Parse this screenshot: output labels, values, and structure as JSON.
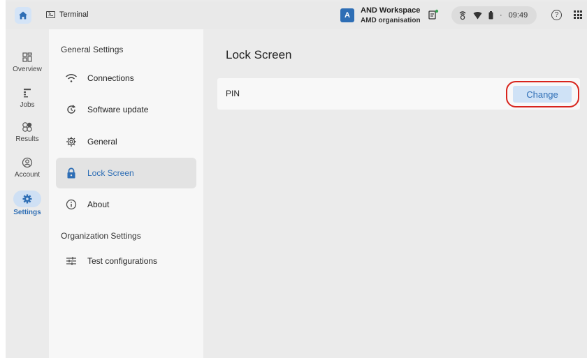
{
  "topbar": {
    "terminal_label": "Terminal",
    "workspace_initial": "A",
    "workspace_name": "AND Workspace",
    "organisation": "AMD organisation",
    "time": "09:49",
    "separator": "·",
    "help_glyph": "?"
  },
  "rail": {
    "items": [
      {
        "label": "Overview",
        "icon": "dashboard-icon"
      },
      {
        "label": "Jobs",
        "icon": "jobs-icon"
      },
      {
        "label": "Results",
        "icon": "results-icon"
      },
      {
        "label": "Account",
        "icon": "account-icon"
      },
      {
        "label": "Settings",
        "icon": "gear-icon",
        "active": true
      }
    ]
  },
  "nav": {
    "general_heading": "General Settings",
    "items": [
      {
        "label": "Connections",
        "icon": "wifi-icon"
      },
      {
        "label": "Software update",
        "icon": "update-icon"
      },
      {
        "label": "General",
        "icon": "gear-icon"
      },
      {
        "label": "Lock Screen",
        "icon": "lock-icon",
        "active": true
      },
      {
        "label": "About",
        "icon": "info-icon"
      }
    ],
    "org_heading": "Organization Settings",
    "org_items": [
      {
        "label": "Test configurations",
        "icon": "sliders-icon"
      }
    ]
  },
  "main": {
    "title": "Lock Screen",
    "pin_label": "PIN",
    "change_label": "Change"
  },
  "colors": {
    "accent": "#2e6eb5",
    "accent_light": "#cfe2f6",
    "highlight": "#d8241c"
  }
}
